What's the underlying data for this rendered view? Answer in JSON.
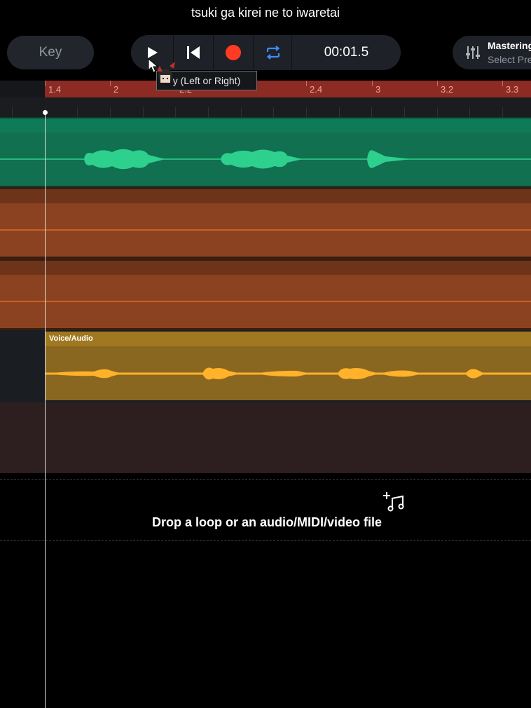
{
  "title": "tsuki ga kirei ne to iwaretai",
  "toolbar": {
    "key_label": "Key",
    "time": "00:01.5",
    "mastering_label": "Mastering",
    "mastering_sub": "Select Preset"
  },
  "tooltip": "y (Left or Right)",
  "ruler": {
    "labels": [
      "1.4",
      "2",
      "2.2",
      "2.4",
      "3",
      "3.2",
      "3.3"
    ]
  },
  "tracks": [
    {
      "name": "",
      "color": "#117050"
    },
    {
      "name": "",
      "color": "#8b4220"
    },
    {
      "name": "",
      "color": "#8b4220"
    },
    {
      "name": "Voice/Audio",
      "color": "#8a6720"
    },
    {
      "name": "",
      "color": "#2d1e20"
    }
  ],
  "drop_zone": {
    "text": "Drop a loop or an audio/MIDI/video file"
  },
  "colors": {
    "ruler": "#8c2a24",
    "green_wave": "#2ed08e",
    "orange_line": "#e06a26",
    "yellow_wave": "#ffb22a",
    "record": "#ff3b24",
    "loop": "#3b8cff"
  },
  "icons": [
    "play-icon",
    "skip-back-icon",
    "record-icon",
    "loop-icon",
    "mixer-icon",
    "add-music-icon",
    "cursor-icon"
  ]
}
